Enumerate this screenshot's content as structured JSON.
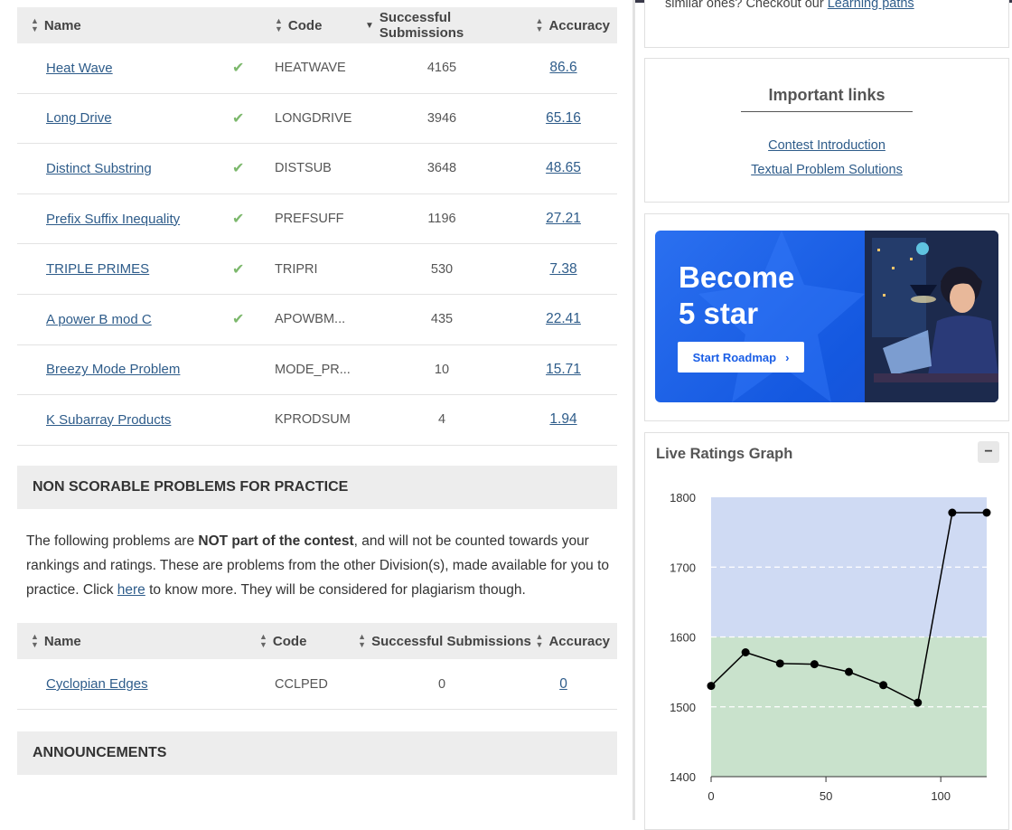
{
  "scorable_table": {
    "headers": {
      "name": "Name",
      "code": "Code",
      "subs": "Successful Submissions",
      "accuracy": "Accuracy"
    },
    "rows": [
      {
        "name": "Heat Wave",
        "solved": true,
        "code": "HEATWAVE",
        "subs": "4165",
        "accuracy": "86.6"
      },
      {
        "name": "Long Drive",
        "solved": true,
        "code": "LONGDRIVE",
        "subs": "3946",
        "accuracy": "65.16"
      },
      {
        "name": "Distinct Substring",
        "solved": true,
        "code": "DISTSUB",
        "subs": "3648",
        "accuracy": "48.65"
      },
      {
        "name": "Prefix Suffix Inequality",
        "solved": true,
        "code": "PREFSUFF",
        "subs": "1196",
        "accuracy": "27.21"
      },
      {
        "name": "TRIPLE PRIMES",
        "solved": true,
        "code": "TRIPRI",
        "subs": "530",
        "accuracy": "7.38"
      },
      {
        "name": "A power B mod C",
        "solved": true,
        "code": "APOWBM...",
        "subs": "435",
        "accuracy": "22.41"
      },
      {
        "name": "Breezy Mode Problem",
        "solved": false,
        "code": "MODE_PR...",
        "subs": "10",
        "accuracy": "15.71"
      },
      {
        "name": "K Subarray Products",
        "solved": false,
        "code": "KPRODSUM",
        "subs": "4",
        "accuracy": "1.94"
      }
    ]
  },
  "non_scorable": {
    "heading": "NON SCORABLE PROBLEMS FOR PRACTICE",
    "para_1": "The following problems are ",
    "para_bold": "NOT part of the contest",
    "para_2": ", and will not be counted towards your rankings and ratings. These are problems from the other Division(s), made available for you to practice. Click ",
    "para_link": "here",
    "para_3": " to know more. They will be considered for plagiarism though.",
    "headers": {
      "name": "Name",
      "code": "Code",
      "subs": "Successful Submissions",
      "accuracy": "Accuracy"
    },
    "rows": [
      {
        "name": "Cyclopian Edges",
        "code": "CCLPED",
        "subs": "0",
        "accuracy": "0"
      }
    ]
  },
  "announcements": {
    "heading": "ANNOUNCEMENTS"
  },
  "learning": {
    "text_prefix": "similar ones? Checkout our ",
    "link": "Learning paths"
  },
  "important_links": {
    "title": "Important links",
    "items": [
      "Contest Introduction",
      "Textual Problem Solutions"
    ]
  },
  "banner": {
    "line1": "Become",
    "line2": "5 star",
    "button": "Start Roadmap"
  },
  "ratings": {
    "title": "Live Ratings Graph",
    "collapse": "−"
  },
  "colors": {
    "band_high": "#cfdaf3",
    "band_low": "#c9e2cc",
    "link": "#2e5c8a",
    "check": "#7cb86c"
  },
  "chart_data": {
    "type": "line",
    "x": [
      0,
      15,
      30,
      45,
      60,
      75,
      90,
      105,
      120
    ],
    "y": [
      1530,
      1578,
      1562,
      1561,
      1550,
      1531,
      1506,
      1778,
      1778
    ],
    "xlim": [
      0,
      120
    ],
    "ylim": [
      1400,
      1800
    ],
    "xticks": [
      0,
      50,
      100
    ],
    "yticks": [
      1400,
      1500,
      1600,
      1700,
      1800
    ],
    "bands": [
      {
        "from": 1400,
        "to": 1600,
        "color": "#c9e2cc"
      },
      {
        "from": 1600,
        "to": 1800,
        "color": "#cfdaf3"
      }
    ],
    "grid": "dashed"
  }
}
